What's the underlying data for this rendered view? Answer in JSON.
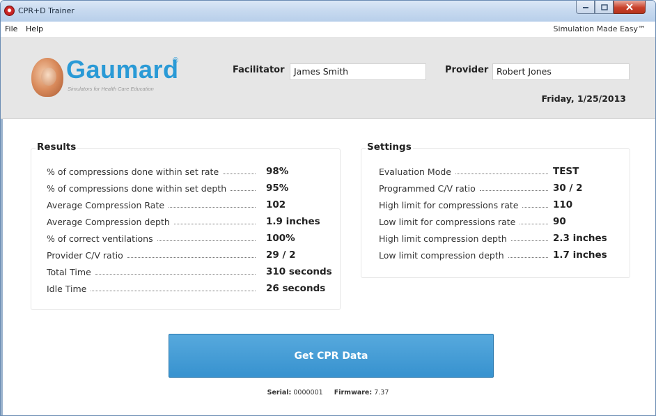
{
  "window": {
    "title": "CPR+D Trainer"
  },
  "menu": {
    "file": "File",
    "help": "Help",
    "tagline": "Simulation Made Easy™"
  },
  "logo": {
    "word": "Gaumard",
    "reg": "®",
    "subtitle": "Simulators for Health Care Education"
  },
  "header": {
    "facilitator_label": "Facilitator",
    "facilitator_value": "James Smith",
    "provider_label": "Provider",
    "provider_value": "Robert Jones",
    "date": "Friday, 1/25/2013"
  },
  "results": {
    "title": "Results",
    "rows": [
      {
        "label": "% of compressions done within set rate",
        "value": "98%"
      },
      {
        "label": "% of compressions done within set depth",
        "value": "95%"
      },
      {
        "label": "Average Compression Rate",
        "value": "102"
      },
      {
        "label": "Average Compression depth",
        "value": "1.9 inches"
      },
      {
        "label": "% of correct ventilations",
        "value": "100%"
      },
      {
        "label": "Provider C/V ratio",
        "value": "29 / 2"
      },
      {
        "label": "Total Time",
        "value": "310 seconds"
      },
      {
        "label": "Idle Time",
        "value": "26 seconds"
      }
    ]
  },
  "settings": {
    "title": "Settings",
    "rows": [
      {
        "label": "Evaluation Mode",
        "value": "TEST"
      },
      {
        "label": "Programmed C/V ratio",
        "value": "30 / 2"
      },
      {
        "label": "High limit for compressions rate",
        "value": "110"
      },
      {
        "label": "Low limit for compressions rate",
        "value": "90"
      },
      {
        "label": "High limit compression depth",
        "value": "2.3 inches"
      },
      {
        "label": "Low limit compression depth",
        "value": "1.7 inches"
      }
    ]
  },
  "action": {
    "get_data_label": "Get CPR Data"
  },
  "footer": {
    "serial_label": "Serial:",
    "serial_value": "0000001",
    "firmware_label": "Firmware:",
    "firmware_value": "7.37"
  }
}
